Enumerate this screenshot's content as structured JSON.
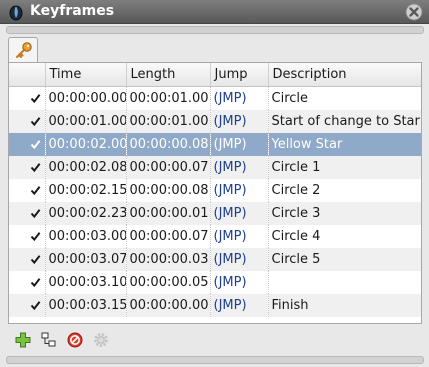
{
  "window": {
    "title": "Keyframes",
    "app_icon": "app-logo-icon",
    "close_icon": "close-icon"
  },
  "tabs": [
    {
      "icon": "key-icon",
      "active": true
    }
  ],
  "table": {
    "columns": [
      "",
      "Time",
      "Length",
      "Jump",
      "Description"
    ],
    "rows": [
      {
        "checked": true,
        "time": "00:00:00.00",
        "length": "00:00:01.00",
        "jump": "(JMP)",
        "description": "Circle",
        "selected": false
      },
      {
        "checked": true,
        "time": "00:00:01.00",
        "length": "00:00:01.00",
        "jump": "(JMP)",
        "description": "Start of change to Star",
        "selected": false
      },
      {
        "checked": true,
        "time": "00:00:02.00",
        "length": "00:00:00.08",
        "jump": "(JMP)",
        "description": "Yellow Star",
        "selected": true
      },
      {
        "checked": true,
        "time": "00:00:02.08",
        "length": "00:00:00.07",
        "jump": "(JMP)",
        "description": "Circle 1",
        "selected": false
      },
      {
        "checked": true,
        "time": "00:00:02.15",
        "length": "00:00:00.08",
        "jump": "(JMP)",
        "description": "Circle 2",
        "selected": false
      },
      {
        "checked": true,
        "time": "00:00:02.23",
        "length": "00:00:00.01",
        "jump": "(JMP)",
        "description": "Circle 3",
        "selected": false
      },
      {
        "checked": true,
        "time": "00:00:03.00",
        "length": "00:00:00.07",
        "jump": "(JMP)",
        "description": "Circle 4",
        "selected": false
      },
      {
        "checked": true,
        "time": "00:00:03.07",
        "length": "00:00:00.03",
        "jump": "(JMP)",
        "description": "Circle 5",
        "selected": false
      },
      {
        "checked": true,
        "time": "00:00:03.10",
        "length": "00:00:00.05",
        "jump": "(JMP)",
        "description": "",
        "selected": false
      },
      {
        "checked": true,
        "time": "00:00:03.15",
        "length": "00:00:00.00",
        "jump": "(JMP)",
        "description": "Finish",
        "selected": false
      }
    ]
  },
  "toolbar": {
    "buttons": [
      {
        "icon": "add-icon"
      },
      {
        "icon": "duplicate-icon"
      },
      {
        "icon": "remove-icon"
      },
      {
        "icon": "settings-icon",
        "disabled": true
      }
    ]
  },
  "colors": {
    "selection": "#8fa9c8",
    "jump_link": "#1e3f8c",
    "titlebar": "#6a6a6a"
  }
}
